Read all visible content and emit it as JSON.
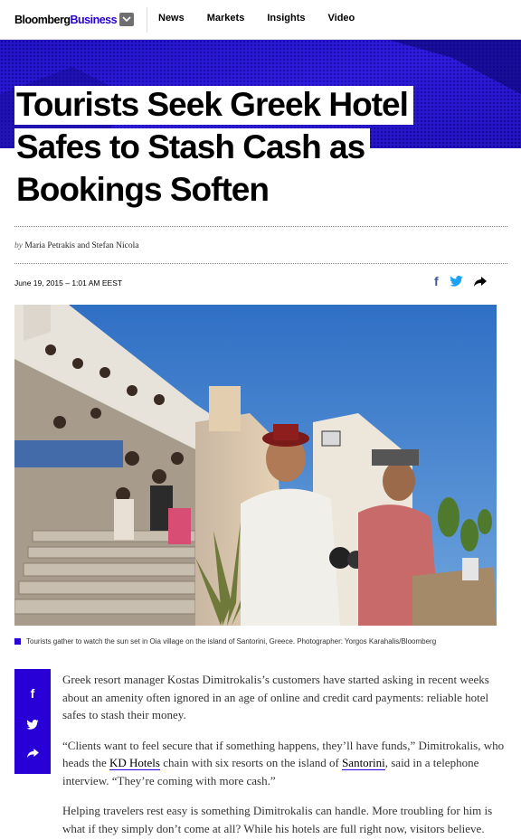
{
  "nav": {
    "logo_main": "Bloomberg",
    "logo_biz": "Business",
    "links": [
      "News",
      "Markets",
      "Insights",
      "Video"
    ]
  },
  "article": {
    "headline_lines": [
      "Tourists Seek Greek Hotel",
      "Safes to Stash Cash as",
      "Bookings Soften"
    ],
    "by": "by",
    "author1": "Maria Petrakis",
    "and": "and",
    "author2": "Stefan Nicola",
    "date": "June 19, 2015 – 1:01 AM EEST",
    "caption": "Tourists gather to watch the sun set in Oia village on the island of Santorini, Greece. Photographer: Yorgos Karahalis/Bloomberg",
    "p1": "Greek resort manager Kostas Dimitrokalis’s customers have started asking in recent weeks about an amenity often ignored in an age of online and credit card payments: reliable hotel safes to stash their money.",
    "p2_a": "“Clients want to feel secure that if something happens, they’ll have funds,” Dimitrokalis, who heads the ",
    "p2_link": "KD Hotels",
    "p2_b": " chain with six resorts on the island of ",
    "p2_link2": "Santorini",
    "p2_c": ", said in a telephone interview. “They’re coming with more cash.”",
    "p3": "Helping travelers rest easy is something Dimitrokalis can handle. More troubling for him is what if they simply don’t come at all? While his hotels are full right now, visitors believe."
  },
  "colors": {
    "accent": "#2800d7",
    "facebook": "#3b5998",
    "twitter": "#1da1f2"
  },
  "icons": {
    "menu": "chevron-down-icon",
    "facebook": "facebook-icon",
    "twitter": "twitter-icon",
    "share": "share-arrow-icon"
  }
}
